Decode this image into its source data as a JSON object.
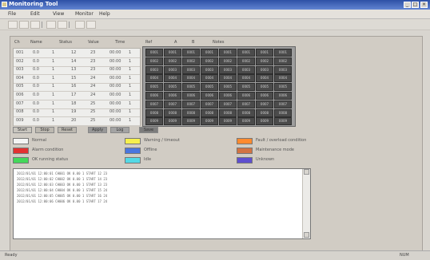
{
  "window": {
    "title": "Monitoring Tool",
    "minimize": "_",
    "maximize": "□",
    "close": "×"
  },
  "menu": [
    "File",
    "Edit",
    "View",
    "Monitor",
    "Help"
  ],
  "grid": {
    "headers": [
      "Ch",
      "Name",
      "Status",
      "Value",
      "Time",
      "Ref",
      "A",
      "B",
      "Notes"
    ],
    "light_rows": [
      [
        "001",
        "0.0",
        "1",
        "12",
        "23",
        "00:00",
        "1"
      ],
      [
        "002",
        "0.0",
        "1",
        "14",
        "23",
        "00:00",
        "1"
      ],
      [
        "003",
        "0.0",
        "1",
        "13",
        "23",
        "00:00",
        "1"
      ],
      [
        "004",
        "0.0",
        "1",
        "15",
        "24",
        "00:00",
        "1"
      ],
      [
        "005",
        "0.0",
        "1",
        "16",
        "24",
        "00:00",
        "1"
      ],
      [
        "006",
        "0.0",
        "1",
        "17",
        "24",
        "00:00",
        "1"
      ],
      [
        "007",
        "0.0",
        "1",
        "18",
        "25",
        "00:00",
        "1"
      ],
      [
        "008",
        "0.0",
        "1",
        "19",
        "25",
        "00:00",
        "1"
      ],
      [
        "009",
        "0.0",
        "1",
        "20",
        "25",
        "00:00",
        "1"
      ]
    ],
    "dark_rows": [
      [
        "0001",
        "0001",
        "0001",
        "0001",
        "0001",
        "0001",
        "0001",
        "0001"
      ],
      [
        "0002",
        "0002",
        "0002",
        "0002",
        "0002",
        "0002",
        "0002",
        "0002"
      ],
      [
        "0003",
        "0003",
        "0003",
        "0003",
        "0003",
        "0003",
        "0003",
        "0003"
      ],
      [
        "0004",
        "0004",
        "0004",
        "0004",
        "0004",
        "0004",
        "0004",
        "0004"
      ],
      [
        "0005",
        "0005",
        "0005",
        "0005",
        "0005",
        "0005",
        "0005",
        "0005"
      ],
      [
        "0006",
        "0006",
        "0006",
        "0006",
        "0006",
        "0006",
        "0006",
        "0006"
      ],
      [
        "0007",
        "0007",
        "0007",
        "0007",
        "0007",
        "0007",
        "0007",
        "0007"
      ],
      [
        "0008",
        "0008",
        "0008",
        "0008",
        "0008",
        "0008",
        "0008",
        "0008"
      ],
      [
        "0009",
        "0009",
        "0009",
        "0009",
        "0009",
        "0009",
        "0009",
        "0009"
      ]
    ]
  },
  "controls": [
    {
      "label": "Start",
      "bg": "#c9c6bf"
    },
    {
      "label": "Stop",
      "bg": "#bcb8b0"
    },
    {
      "label": "Reset",
      "bg": "#bcb8b0"
    },
    {
      "label": "Apply",
      "bg": "#979797"
    },
    {
      "label": "Log",
      "bg": "#a3a3a3"
    },
    {
      "label": "Save",
      "bg": "#7d7d7d"
    }
  ],
  "legend": [
    {
      "label": "Normal",
      "color": "#f4f4f4"
    },
    {
      "label": "Alarm condition",
      "color": "#e33131"
    },
    {
      "label": "OK running status",
      "color": "#44d85a"
    },
    {
      "label": "Warning / timeout",
      "color": "#f6f04f"
    },
    {
      "label": "Offline",
      "color": "#4a76df"
    },
    {
      "label": "Idle",
      "color": "#53d9e6"
    },
    {
      "label": "Fault / overload condition",
      "color": "#ff8a2f"
    },
    {
      "label": "Maintenance mode",
      "color": "#d27343"
    },
    {
      "label": "Unknown",
      "color": "#5e4fcf"
    }
  ],
  "log": [
    "2012/01/01  12:00:01  CH001  OK  0.00  1  START  12  23",
    "2012/01/01  12:00:02  CH002  OK  0.00  1  START  14  23",
    "2012/01/01  12:00:03  CH003  OK  0.00  1  START  13  23",
    "2012/01/01  12:00:04  CH004  OK  0.00  1  START  15  24",
    "2012/01/01  12:00:05  CH005  OK  0.00  1  START  16  24",
    "2012/01/01  12:00:06  CH006  OK  0.00  1  START  17  24"
  ],
  "status": {
    "left": "Ready",
    "right": "NUM"
  }
}
